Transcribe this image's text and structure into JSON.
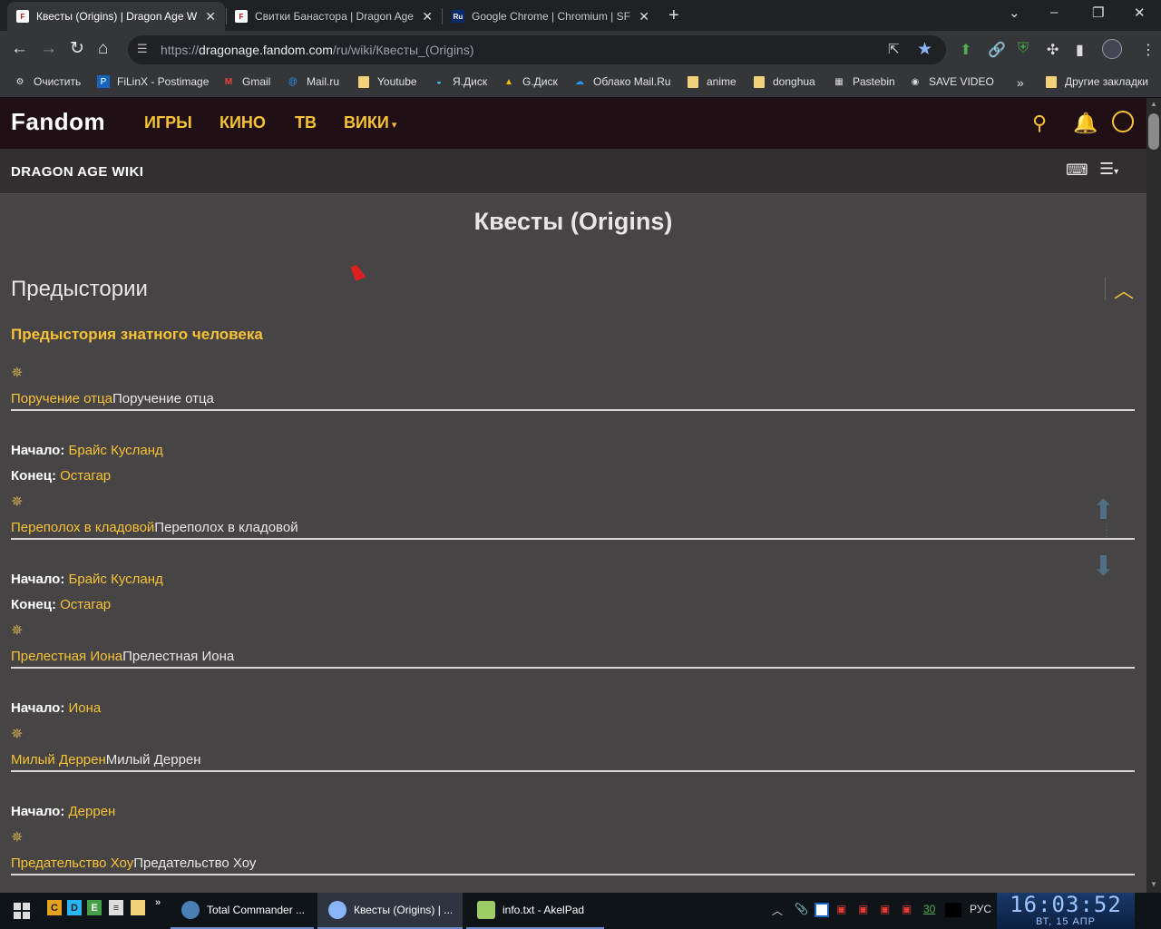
{
  "browser": {
    "tabs": [
      {
        "title": "Квесты (Origins) | Dragon Age W",
        "favicon": "F",
        "active": true
      },
      {
        "title": "Свитки Банастора | Dragon Age",
        "favicon": "F",
        "active": false
      },
      {
        "title": "Google Chrome | Chromium | SF",
        "favicon": "Ru",
        "active": false
      }
    ],
    "new_tab_icon": "+",
    "url_prefix": "https://",
    "url_host": "dragonage.fandom.com",
    "url_path": "/ru/wiki/Квесты_(Origins)",
    "bookmarks": [
      {
        "label": "Очистить",
        "icon": "gear"
      },
      {
        "label": "FiLinX - Postimage",
        "icon": "P"
      },
      {
        "label": "Gmail",
        "icon": "M"
      },
      {
        "label": "Mail.ru",
        "icon": "@"
      },
      {
        "label": "Youtube",
        "icon": "folder"
      },
      {
        "label": "Я.Диск",
        "icon": "disk"
      },
      {
        "label": "G.Диск",
        "icon": "gdrive"
      },
      {
        "label": "Облако Mail.Ru",
        "icon": "cloud"
      },
      {
        "label": "anime",
        "icon": "folder"
      },
      {
        "label": "donghua",
        "icon": "folder"
      },
      {
        "label": "Pastebin",
        "icon": "paste"
      },
      {
        "label": "SAVE VIDEO",
        "icon": "globe"
      }
    ],
    "bookmarks_more": "»",
    "other_bookmarks": "Другие закладки"
  },
  "fandom": {
    "logo": "Fandom",
    "nav": [
      "ИГРЫ",
      "КИНО",
      "ТВ",
      "ВИКИ"
    ],
    "wiki_title": "DRAGON AGE WIKI"
  },
  "page": {
    "title": "Квесты (Origins)",
    "section": "Предыстории",
    "subsection": "Предыстория знатного человека",
    "start_label": "Начало:",
    "end_label": "Конец:",
    "quests": [
      {
        "name": "Поручение отца",
        "start": "Брайс Кусланд",
        "end": "Остагар"
      },
      {
        "name": "Переполох в кладовой",
        "start": "Брайс Кусланд",
        "end": "Остагар"
      },
      {
        "name": "Прелестная Иона",
        "start": "Иона",
        "end": ""
      },
      {
        "name": "Милый Деррен",
        "start": "Деррен",
        "end": ""
      },
      {
        "name": "Предательство Хоу",
        "start": "",
        "end": ""
      }
    ]
  },
  "taskbar": {
    "quicklaunch": [
      "C",
      "D",
      "E"
    ],
    "tasks": [
      "Total Commander ...",
      "Квесты (Origins) | ...",
      "info.txt - AkelPad"
    ],
    "tray_number": "30",
    "language": "РУС",
    "time": "16:03:52",
    "date": "ВТ, 15  АПР"
  },
  "colors": {
    "accent": "#f7c234",
    "background": "#474446",
    "nav": "#210f16"
  }
}
